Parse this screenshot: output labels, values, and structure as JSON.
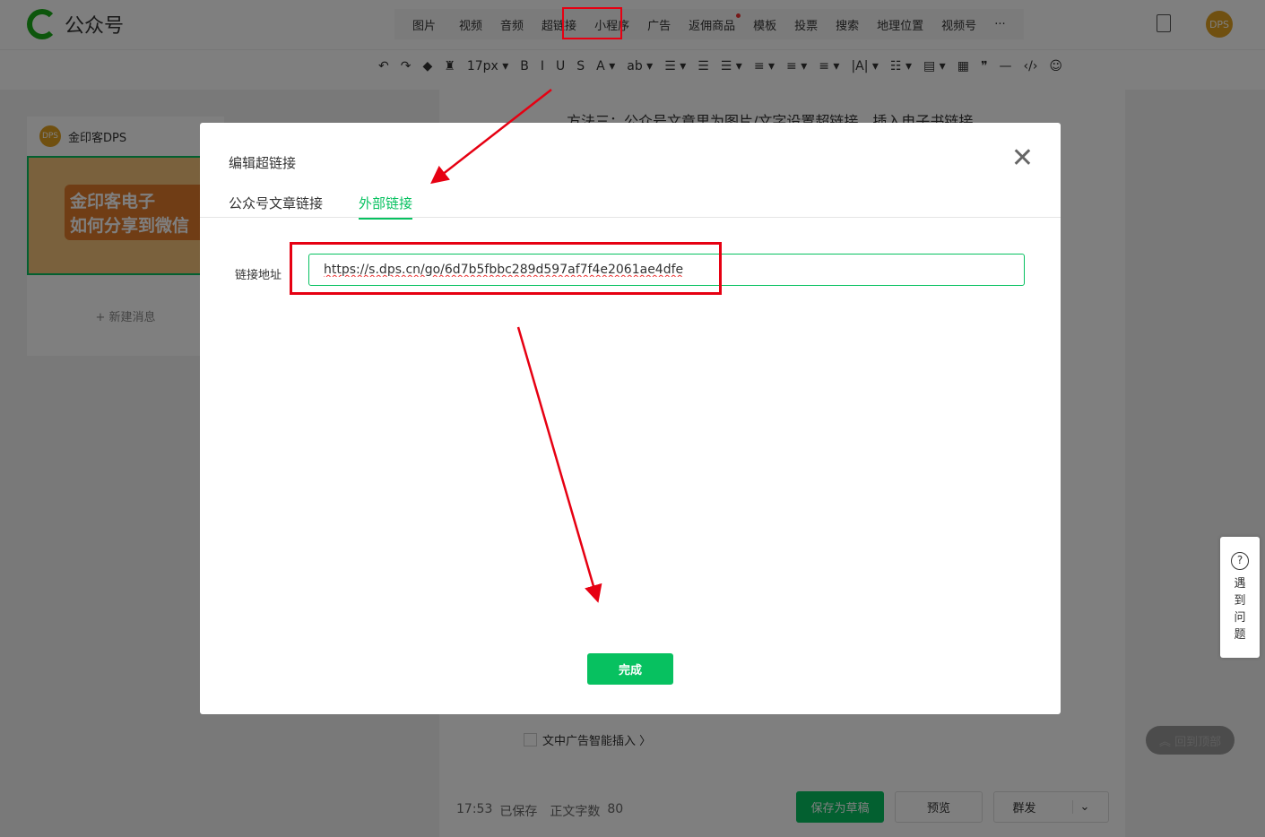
{
  "app": {
    "title": "公众号",
    "avatar": "DPS"
  },
  "nav": [
    {
      "label": "图片",
      "dd": true
    },
    {
      "label": "视频"
    },
    {
      "label": "音频"
    },
    {
      "label": "超链接"
    },
    {
      "label": "小程序"
    },
    {
      "label": "广告"
    },
    {
      "label": "返佣商品",
      "dot": true
    },
    {
      "label": "模板"
    },
    {
      "label": "投票"
    },
    {
      "label": "搜索"
    },
    {
      "label": "地理位置"
    },
    {
      "label": "视频号"
    },
    {
      "label": "···"
    }
  ],
  "toolbar": [
    "↶",
    "↷",
    "◆",
    "♜",
    "17px ▾",
    "B",
    "I",
    "U",
    "S",
    "A ▾",
    "ab ▾",
    "☰ ▾",
    "☰",
    "☰ ▾",
    "≡ ▾",
    "≡ ▾",
    "≡ ▾",
    "|A| ▾",
    "☷ ▾",
    "▤ ▾",
    "▦",
    "❞",
    "—",
    "‹/›",
    "☺"
  ],
  "left": {
    "account": "金印客DPS",
    "cover_line1": "金印客电子",
    "cover_line2": "如何分享到微信",
    "new_message": "新建消息"
  },
  "editor": {
    "heading": "方法三：公众号文章里为图片/文字设置超链接，插入电子书链接",
    "ad_option": "文中广告智能插入 〉"
  },
  "bottom": {
    "time": "17:53",
    "saved": "已保存",
    "word_count_label": "正文字数",
    "word_count": "80",
    "save_draft": "保存为草稿",
    "preview": "预览",
    "publish": "群发"
  },
  "help": {
    "label": "遇到问题"
  },
  "back_to_top": "回到顶部",
  "modal": {
    "title": "编辑超链接",
    "tabs": [
      {
        "label": "公众号文章链接"
      },
      {
        "label": "外部链接",
        "active": true
      }
    ],
    "field_label": "链接地址",
    "url": "https://s.dps.cn/go/6d7b5fbbc289d597af7f4e2061ae4dfe",
    "done": "完成"
  },
  "colors": {
    "accent": "#07c160",
    "annotation": "#e60012"
  }
}
